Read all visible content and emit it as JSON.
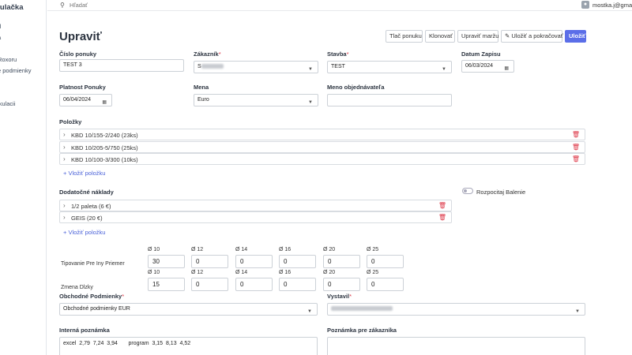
{
  "sidebar": {
    "brand": "lkulačka",
    "items": [
      {
        "label": "d"
      },
      {
        "label": "a"
      },
      {
        "label": "Roxoru"
      },
      {
        "label": "e podmienky"
      },
      {
        "label": "lkulacii"
      }
    ]
  },
  "topbar": {
    "search_placeholder": "Hľadať",
    "user_email": "mostka.j@gmail"
  },
  "page": {
    "title": "Upraviť"
  },
  "toolbar": {
    "print": "Tlač ponuku",
    "clone": "Klonovať",
    "edit_margin": "Upraviť maržu",
    "save_continue": "Uložiť a pokračovať",
    "save": "Uložiť"
  },
  "form": {
    "offer_number": {
      "label": "Číslo ponuky",
      "value": "TEST 3"
    },
    "customer": {
      "label": "Zákazník",
      "value": "S"
    },
    "construction": {
      "label": "Stavba",
      "value": "TEST"
    },
    "record_date": {
      "label": "Datum Zapisu",
      "value": "06/03/2024"
    },
    "validity": {
      "label": "Platnost Ponuky",
      "value": "06/04/2024"
    },
    "currency": {
      "label": "Mena",
      "value": "Euro"
    },
    "orderer_name": {
      "label": "Meno objednávateľa",
      "value": ""
    }
  },
  "items": {
    "heading": "Položky",
    "rows": [
      {
        "label": "KBD 10/155-2/240 (23ks)"
      },
      {
        "label": "KBD 10/205-5/750 (25ks)"
      },
      {
        "label": "KBD 10/100-3/300 (10ks)"
      }
    ],
    "add_label": "+ Vložiť položku"
  },
  "extra_costs": {
    "heading": "Dodatočné náklady",
    "rows": [
      {
        "label": "1/2 paleta (6 €)"
      },
      {
        "label": "GEIS (20 €)"
      }
    ],
    "add_label": "+ Vložiť položku",
    "packaging_toggle_label": "Rozpocitaj Balenie"
  },
  "diameters": {
    "labels": [
      "Ø 10",
      "Ø 12",
      "Ø 14",
      "Ø 16",
      "Ø 20",
      "Ø 25"
    ],
    "row1_label": "Tipovanie Pre Iny Priemer",
    "row1_values": [
      "30",
      "0",
      "0",
      "0",
      "0",
      "0"
    ],
    "row2_label": "Zmena Dlzky",
    "row2_values": [
      "15",
      "0",
      "0",
      "0",
      "0",
      "0"
    ]
  },
  "terms": {
    "label": "Obchodné Podmienky",
    "value": "Obchodné podmienky EUR"
  },
  "issuer": {
    "label": "Vystavil",
    "value": ""
  },
  "notes": {
    "internal_label": "Interná poznámka",
    "internal_value": "excel  2,79  7,24  3,94       program  3,15  8,13  4,52",
    "customer_label": "Poznámka pre zákazníka",
    "customer_value": ""
  }
}
